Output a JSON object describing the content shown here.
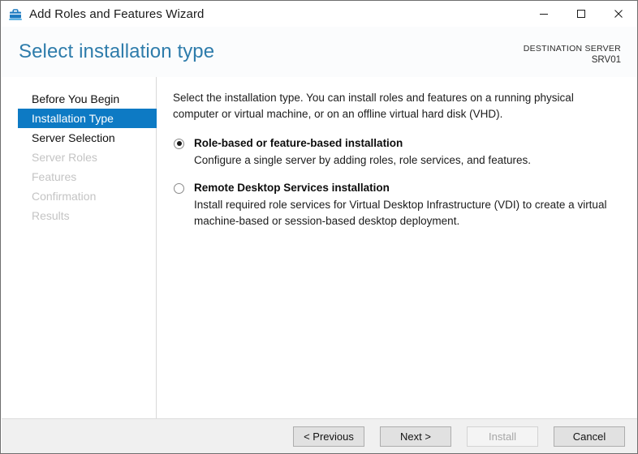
{
  "window": {
    "title": "Add Roles and Features Wizard",
    "icon": "wizard-toolbox-icon",
    "controls": {
      "minimize": "minimize-icon",
      "maximize": "maximize-icon",
      "close": "close-icon"
    }
  },
  "header": {
    "page_title": "Select installation type",
    "destination_label": "DESTINATION SERVER",
    "destination_value": "SRV01",
    "accent_color": "#2e7cab"
  },
  "sidebar": {
    "items": [
      {
        "label": "Before You Begin",
        "state": "enabled"
      },
      {
        "label": "Installation Type",
        "state": "active"
      },
      {
        "label": "Server Selection",
        "state": "enabled"
      },
      {
        "label": "Server Roles",
        "state": "disabled"
      },
      {
        "label": "Features",
        "state": "disabled"
      },
      {
        "label": "Confirmation",
        "state": "disabled"
      },
      {
        "label": "Results",
        "state": "disabled"
      }
    ],
    "active_color": "#0d7ac4"
  },
  "main": {
    "intro": "Select the installation type. You can install roles and features on a running physical computer or virtual machine, or on an offline virtual hard disk (VHD).",
    "options": [
      {
        "title": "Role-based or feature-based installation",
        "description": "Configure a single server by adding roles, role services, and features.",
        "selected": true
      },
      {
        "title": "Remote Desktop Services installation",
        "description": "Install required role services for Virtual Desktop Infrastructure (VDI) to create a virtual machine-based or session-based desktop deployment.",
        "selected": false
      }
    ]
  },
  "footer": {
    "buttons": [
      {
        "label": "< Previous",
        "enabled": true
      },
      {
        "label": "Next >",
        "enabled": true
      },
      {
        "label": "Install",
        "enabled": false
      },
      {
        "label": "Cancel",
        "enabled": true
      }
    ]
  }
}
